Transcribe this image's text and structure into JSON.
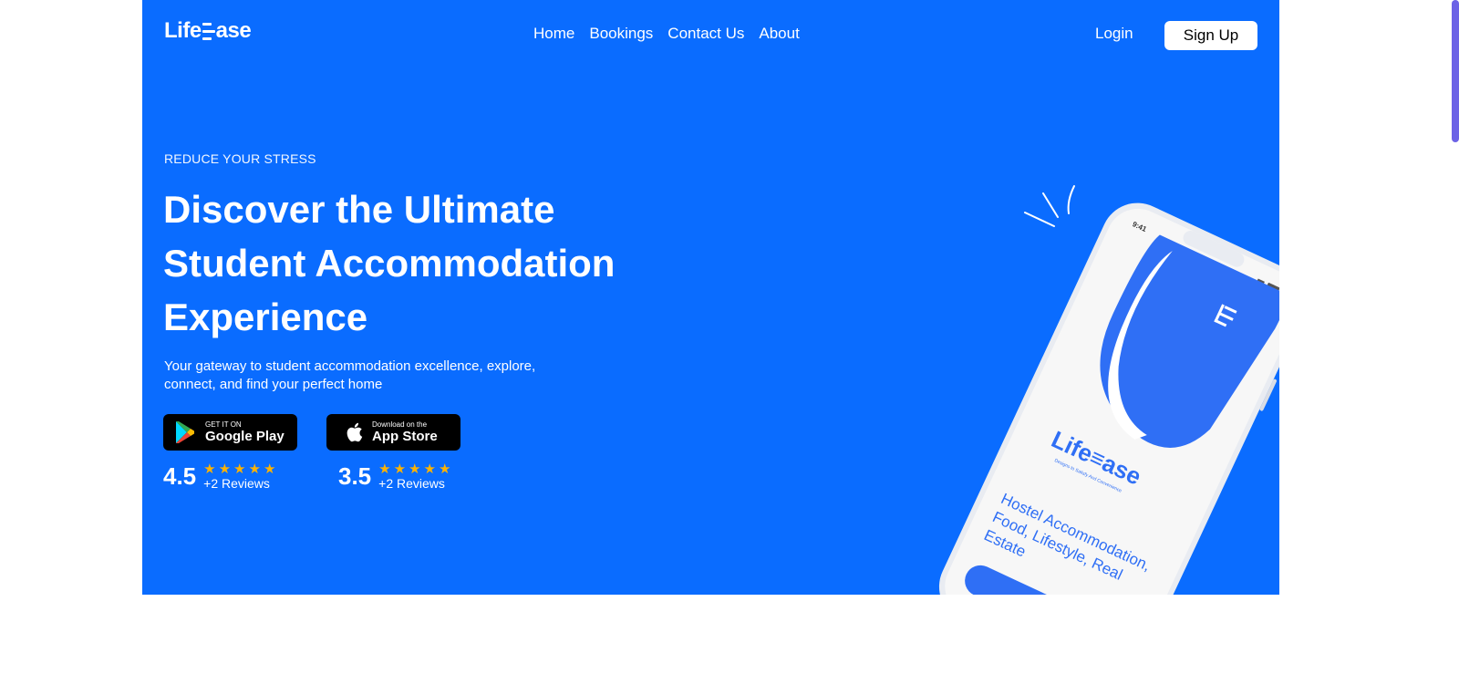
{
  "header": {
    "logo_left": "Life",
    "logo_right": "ase",
    "nav": [
      "Home",
      "Bookings",
      "Contact Us",
      "About"
    ],
    "login_label": "Login",
    "signup_label": "Sign Up"
  },
  "hero": {
    "eyebrow": "REDUCE YOUR STRESS",
    "headline_lines": [
      "Discover the Ultimate",
      "Student Accommodation",
      "Experience"
    ],
    "subtext_lines": [
      "Your gateway to student accommodation excellence, explore,",
      "connect, and find your perfect home"
    ]
  },
  "stores": {
    "google": {
      "small": "GET IT ON",
      "big": "Google Play",
      "rating": "4.5",
      "reviews": "+2 Reviews"
    },
    "apple": {
      "small": "Download on the",
      "big": "App Store",
      "rating": "3.5",
      "reviews": "+2 Reviews"
    }
  },
  "phone": {
    "time": "9:41",
    "logo_text": "Life≡ase",
    "tagline": "Designs to Satisfy And Convenience",
    "lines": [
      "Hostel Accommodation,",
      "Food, Lifestyle, Real",
      "Estate"
    ]
  },
  "colors": {
    "brand_blue": "#0a6cff",
    "star": "#ffb300",
    "scroll_thumb": "#6c63e6"
  }
}
